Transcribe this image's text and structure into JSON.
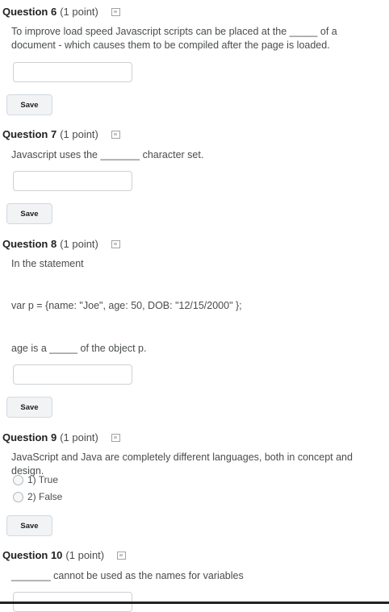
{
  "save_label": "Save",
  "questions": [
    {
      "num": "Question 6",
      "points": "(1 point)",
      "text": "To improve load speed Javascript scripts can be placed at the _____ of a document - which causes them to be compiled after the page is loaded."
    },
    {
      "num": "Question 7",
      "points": "(1 point)",
      "text": "Javascript uses the _______ character set."
    },
    {
      "num": "Question 8",
      "points": "(1 point)",
      "text": "In the statement",
      "code": "var p = {name: \"Joe\", age: 50, DOB: \"12/15/2000\" };",
      "text2": "age is a _____ of the object p."
    },
    {
      "num": "Question 9",
      "points": "(1 point)",
      "text": "JavaScript and Java are completely different languages, both in concept and design.",
      "options": [
        "1) True",
        "2) False"
      ]
    },
    {
      "num": "Question 10",
      "points": "(1 point)",
      "text": "_______ cannot be used as the names for variables"
    }
  ]
}
